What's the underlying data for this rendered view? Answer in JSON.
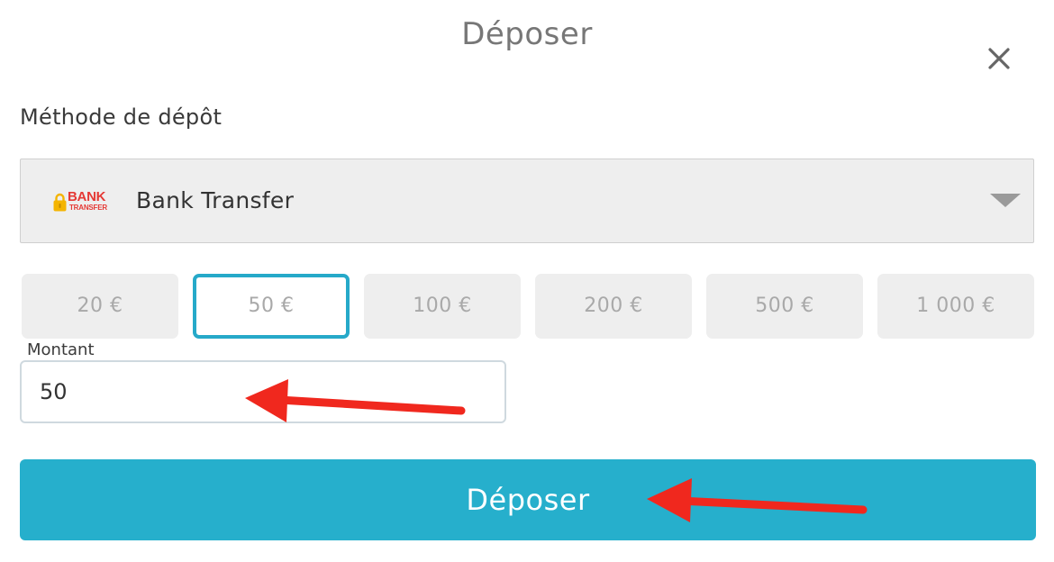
{
  "dialog": {
    "title": "Déposer",
    "close_icon": "close-icon"
  },
  "deposit_method": {
    "label": "Méthode de dépôt",
    "selected_value": "Bank Transfer",
    "logo": {
      "line1": "BANK",
      "line2": "TRANSFER",
      "color": "#e53935"
    },
    "dropdown_icon": "triangle-down-icon"
  },
  "amount_presets": [
    {
      "label": "20 €",
      "selected": false
    },
    {
      "label": "50 €",
      "selected": true
    },
    {
      "label": "100 €",
      "selected": false
    },
    {
      "label": "200 €",
      "selected": false
    },
    {
      "label": "500 €",
      "selected": false
    },
    {
      "label": "1 000 €",
      "selected": false
    }
  ],
  "amount": {
    "label": "Montant",
    "value": "50"
  },
  "submit_button": {
    "label": "Déposer"
  },
  "colors": {
    "accent": "#26afcc",
    "selected_border": "#26a9c9",
    "annotation_arrow": "#f0281e"
  }
}
